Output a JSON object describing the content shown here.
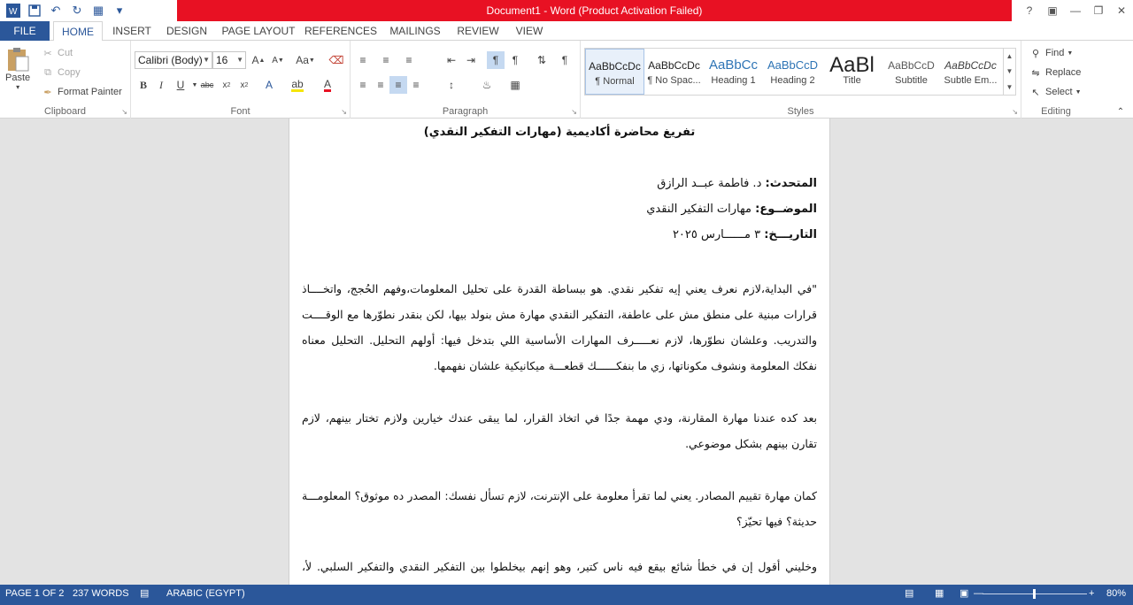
{
  "window": {
    "title": "Document1 -  Word (Product Activation Failed)",
    "help": "?",
    "controls": [
      "restore-ribbon",
      "minimize",
      "restore",
      "close"
    ]
  },
  "tabs": [
    "FILE",
    "HOME",
    "INSERT",
    "DESIGN",
    "PAGE LAYOUT",
    "REFERENCES",
    "MAILINGS",
    "REVIEW",
    "VIEW"
  ],
  "active_tab": "HOME",
  "clipboard": {
    "paste": "Paste",
    "cut": "Cut",
    "copy": "Copy",
    "format_painter": "Format Painter",
    "label": "Clipboard"
  },
  "font": {
    "name": "Calibri (Body)",
    "size": "16",
    "label": "Font",
    "aa": "Aa"
  },
  "paragraph": {
    "label": "Paragraph"
  },
  "styles": {
    "label": "Styles",
    "items": [
      {
        "preview": "AaBbCcDc",
        "name": "¶ Normal",
        "color": "#222222"
      },
      {
        "preview": "AaBbCcDc",
        "name": "¶ No Spac...",
        "color": "#222222"
      },
      {
        "preview": "AaBbCc",
        "name": "Heading 1",
        "color": "#2e74b5"
      },
      {
        "preview": "AaBbCcD",
        "name": "Heading 2",
        "color": "#2e74b5"
      },
      {
        "preview": "AaBl",
        "name": "Title",
        "color": "#222222"
      },
      {
        "preview": "AaBbCcD",
        "name": "Subtitle",
        "color": "#595959"
      },
      {
        "preview": "AaBbCcDc",
        "name": "Subtle Em...",
        "color": "#404040"
      }
    ]
  },
  "editing": {
    "find": "Find",
    "replace": "Replace",
    "select": "Select",
    "label": "Editing"
  },
  "document": {
    "title": "تفريغ محاضرة أكاديمية (مهارات التفكير النقدي)",
    "speaker_label": "المتحدث:",
    "speaker": " د. فاطمة عبــد الرازق",
    "topic_label": "الموضــوع:",
    "topic": " مهارات التفكير النقدي",
    "date_label": "التاريـــخ:",
    "date": " ٣ مــــــارس ٢٠٢٥",
    "paragraphs": [
      "\"في البداية،لازم نعرف يعني إيه تفكير نقدي. هو ببساطة القدرة على تحليل المعلومات،وفهم الحُجج، واتخــــاذ قرارات مبنية على منطق مش على عاطفة، التفكير النقدي مهارة مش بنولد بيها، لكن بنقدر نطوّرها مع الوقــــت والتدريب. وعلشان نطوّرها، لازم نعـــــرف المهارات الأساسية اللي بتدخل فيها: أولهم التحليل. التحليل معناه نفكك المعلومة ونشوف مكوناتها، زي ما بنفكــــــك قطعـــة ميكانيكية علشان نفهمها.",
      "بعد كده عندنا مهارة المقارنة، ودي مهمة جدًا في اتخاذ القرار، لما يبقى عندك خيارين ولازم تختار بينهم، لازم تقارن بينهم بشكل موضوعي.",
      "كمان مهارة تقييم المصادر. يعني لما تقرأ معلومة على الإنترنت، لازم تسأل نفسك: المصدر ده موثوق؟ المعلومـــة حديثة؟ فيها تحيّز؟",
      "وخليني أقول إن في خطأ شائع بيقع فيه ناس كتير، وهو إنهم بيخلطوا بين التفكير النقدي والتفكير السلبي. لأ، النقدي مش معناه نرفض كل حاجة، لكنه معناه نحلل ونقيم ونبقى منفتحين ومتقبلين للنقاش."
    ]
  },
  "status": {
    "page": "PAGE 1 OF 2",
    "words": "237 WORDS",
    "language": "ARABIC (EGYPT)",
    "zoom": "80%",
    "zoom_level": 0.8
  }
}
